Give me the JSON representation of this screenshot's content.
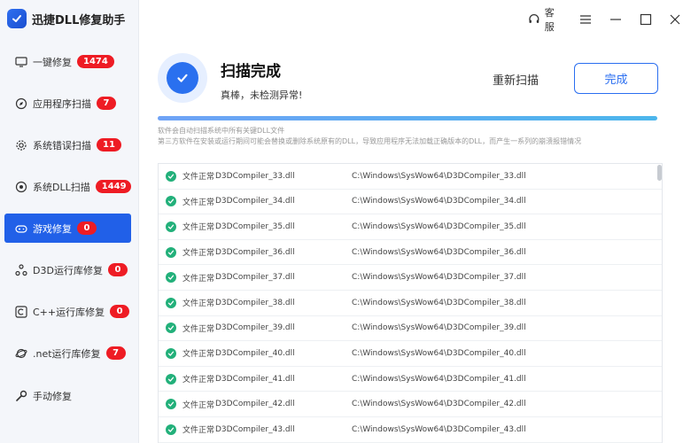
{
  "app": {
    "title": "迅捷DLL修复助手"
  },
  "titlebar": {
    "service_label": "客服"
  },
  "sidebar": {
    "items": [
      {
        "label": "一键修复",
        "badge": "1474",
        "icon": "monitor-icon",
        "active": false
      },
      {
        "label": "应用程序扫描",
        "badge": "7",
        "icon": "compass-icon",
        "active": false
      },
      {
        "label": "系统错误扫描",
        "badge": "11",
        "icon": "gear-icon",
        "active": false
      },
      {
        "label": "系统DLL扫描",
        "badge": "1449",
        "icon": "target-icon",
        "active": false
      },
      {
        "label": "游戏修复",
        "badge": "0",
        "icon": "gamepad-icon",
        "active": true
      },
      {
        "label": "D3D运行库修复",
        "badge": "0",
        "icon": "molecule-icon",
        "active": false
      },
      {
        "label": "C++运行库修复",
        "badge": "0",
        "icon": "c-letter-icon",
        "active": false
      },
      {
        "label": ".net运行库修复",
        "badge": "7",
        "icon": "orbit-icon",
        "active": false
      },
      {
        "label": "手动修复",
        "badge": "",
        "icon": "wrench-icon",
        "active": false
      }
    ]
  },
  "header": {
    "title": "扫描完成",
    "subtitle": "真棒，未检测异常!",
    "rescan_label": "重新扫描",
    "done_label": "完成",
    "progress": 1.0
  },
  "description": {
    "line1": "软件会自动扫描系统中所有关键DLL文件",
    "line2": "第三方软件在安装或运行期间可能会替换或删除系统原有的DLL，导致应用程序无法加载正确版本的DLL，而产生一系列的崩溃报错情况"
  },
  "results": {
    "rows": [
      {
        "status": "文件正常",
        "file": "D3DCompiler_33.dll",
        "path": "C:\\Windows\\SysWow64\\D3DCompiler_33.dll"
      },
      {
        "status": "文件正常",
        "file": "D3DCompiler_34.dll",
        "path": "C:\\Windows\\SysWow64\\D3DCompiler_34.dll"
      },
      {
        "status": "文件正常",
        "file": "D3DCompiler_35.dll",
        "path": "C:\\Windows\\SysWow64\\D3DCompiler_35.dll"
      },
      {
        "status": "文件正常",
        "file": "D3DCompiler_36.dll",
        "path": "C:\\Windows\\SysWow64\\D3DCompiler_36.dll"
      },
      {
        "status": "文件正常",
        "file": "D3DCompiler_37.dll",
        "path": "C:\\Windows\\SysWow64\\D3DCompiler_37.dll"
      },
      {
        "status": "文件正常",
        "file": "D3DCompiler_38.dll",
        "path": "C:\\Windows\\SysWow64\\D3DCompiler_38.dll"
      },
      {
        "status": "文件正常",
        "file": "D3DCompiler_39.dll",
        "path": "C:\\Windows\\SysWow64\\D3DCompiler_39.dll"
      },
      {
        "status": "文件正常",
        "file": "D3DCompiler_40.dll",
        "path": "C:\\Windows\\SysWow64\\D3DCompiler_40.dll"
      },
      {
        "status": "文件正常",
        "file": "D3DCompiler_41.dll",
        "path": "C:\\Windows\\SysWow64\\D3DCompiler_41.dll"
      },
      {
        "status": "文件正常",
        "file": "D3DCompiler_42.dll",
        "path": "C:\\Windows\\SysWow64\\D3DCompiler_42.dll"
      },
      {
        "status": "文件正常",
        "file": "D3DCompiler_43.dll",
        "path": "C:\\Windows\\SysWow64\\D3DCompiler_43.dll"
      }
    ]
  },
  "colors": {
    "accent": "#2160e8",
    "badge": "#ee1c24",
    "ok": "#22b07a"
  }
}
